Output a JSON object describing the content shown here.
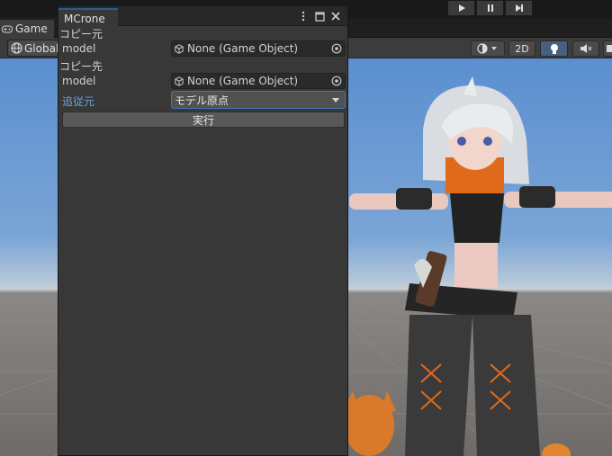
{
  "toolbar": {
    "play_icon": "play-icon",
    "pause_icon": "pause-icon",
    "step_icon": "step-icon"
  },
  "game_tab": {
    "label": "Game",
    "icon": "gamepad-icon"
  },
  "game_toolbar": {
    "global_label": "Global",
    "mode_2d_label": "2D",
    "icons": [
      "shading-mode-icon",
      "lighting-icon",
      "audio-mute-icon",
      "scene-gizmo-icon"
    ]
  },
  "panel": {
    "title": "MCrone",
    "controls": [
      "more-menu-icon",
      "maximize-icon",
      "close-icon"
    ],
    "source_section": "コピー元",
    "source_field_label": "model",
    "source_value": "None (Game Object)",
    "dest_section": "コピー先",
    "dest_field_label": "model",
    "dest_value": "None (Game Object)",
    "follow_label": "追従元",
    "follow_value": "モデル原点",
    "execute_label": "実行"
  },
  "colors": {
    "accent": "#3a79bb",
    "follow_label": "#6fa1d6",
    "panel_bg": "#383838"
  }
}
